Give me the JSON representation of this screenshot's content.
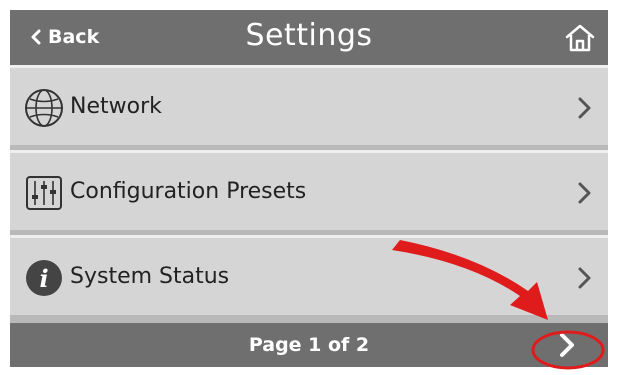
{
  "header": {
    "back_label": "Back",
    "title": "Settings",
    "home_icon": "home-icon"
  },
  "items": [
    {
      "label": "Network",
      "icon": "globe-icon"
    },
    {
      "label": "Configuration Presets",
      "icon": "sliders-icon"
    },
    {
      "label": "System Status",
      "icon": "info-icon"
    }
  ],
  "footer": {
    "page_label": "Page 1 of 2",
    "next_icon": "chevron-right-icon"
  },
  "annotation": {
    "arrow_color": "#e01b1b",
    "highlight_color": "#e01b1b"
  },
  "colors": {
    "header_bg": "#6f6f6f",
    "item_bg": "#d5d5d5",
    "text": "#222222"
  }
}
